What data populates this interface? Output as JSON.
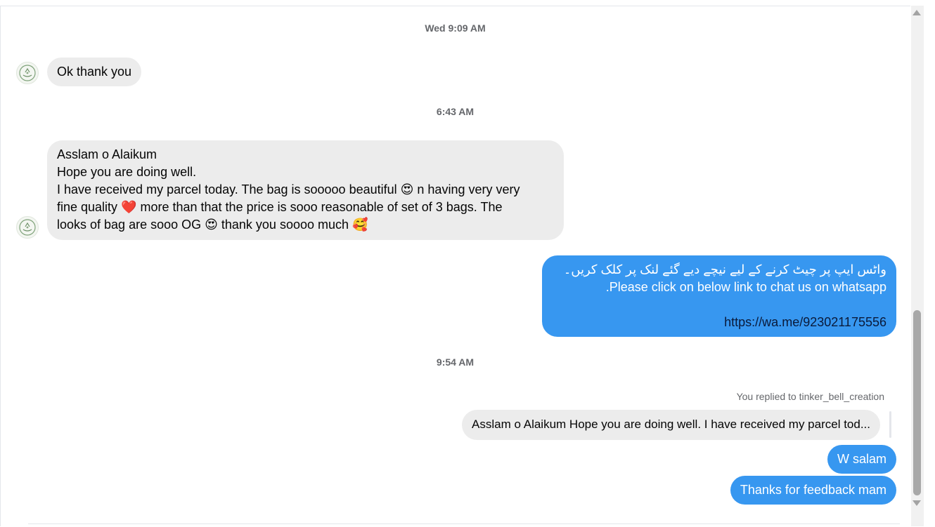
{
  "timestamps": {
    "t1": "Wed 9:09 AM",
    "t2": "6:43 AM",
    "t3": "9:54 AM"
  },
  "messages": {
    "m1": {
      "text": "Ok thank you"
    },
    "m2": {
      "line1": "Asslam o Alaikum",
      "line2": "Hope you are doing well.",
      "line3a": "I have received my parcel today. The bag is sooooo beautiful ",
      "line3_emoji": "😍",
      "line3b": " n having very very",
      "line4a": "fine quality ",
      "line4_emoji": "❤️",
      "line4b": " more than that the price is sooo reasonable of set of 3 bags.  The",
      "line5a": "looks of bag are sooo OG ",
      "line5_emoji": "😍",
      "line5b": " thank you soooo much ",
      "line5_emoji2": "🥰"
    },
    "m3": {
      "urdu": "واٹس ایپ پر چیٹ کرنے کے لیے نیچے دیے گئے لنک پر کلک کریں۔",
      "english": ".Please click on below link to chat us on whatsapp",
      "link": "https://wa.me/923021175556"
    },
    "reply_note": "You replied to tinker_bell_creation",
    "quoted": "Asslam o Alaikum Hope you are doing well. I have received my parcel tod...",
    "m4": {
      "text": "W salam"
    },
    "m5": {
      "text": "Thanks for feedback mam"
    }
  },
  "colors": {
    "outgoing_bubble": "#3797f0",
    "incoming_bubble": "#ececec",
    "timestamp": "#65676b"
  },
  "icons": {
    "avatar": "brand-logo-avatar",
    "scroll_up": "scroll-up-arrow",
    "scroll_down": "scroll-down-arrow"
  }
}
